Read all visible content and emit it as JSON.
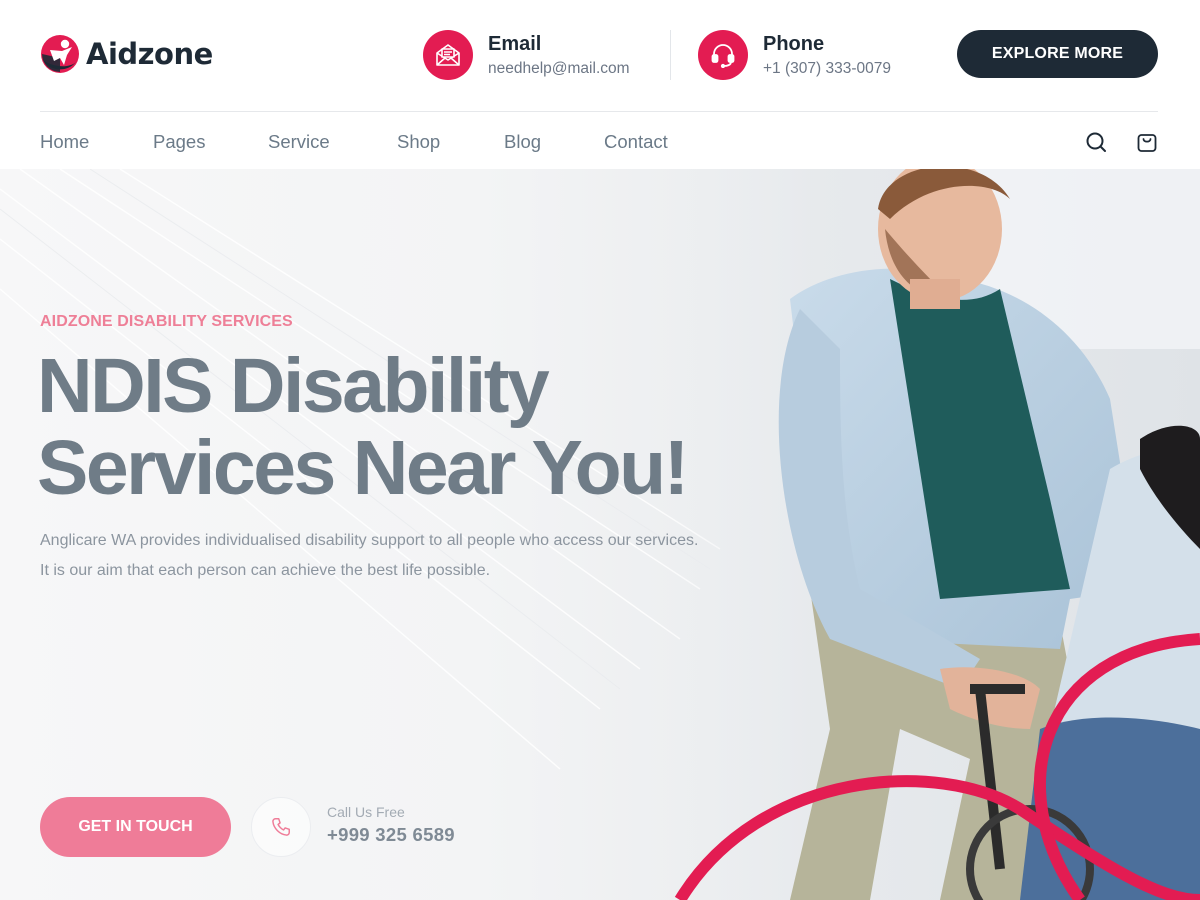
{
  "brand": {
    "name": "Aidzone",
    "accent": "#e31c52",
    "dark": "#1e2a36",
    "pink": "#ef7c98"
  },
  "header": {
    "email": {
      "title": "Email",
      "value": "needhelp@mail.com",
      "icon": "envelope-icon"
    },
    "phone": {
      "title": "Phone",
      "value": "+1 (307) 333-0079",
      "icon": "headset-icon"
    },
    "cta_label": "EXPLORE MORE"
  },
  "nav": {
    "items": [
      {
        "label": "Home"
      },
      {
        "label": "Pages"
      },
      {
        "label": "Service"
      },
      {
        "label": "Shop"
      },
      {
        "label": "Blog"
      },
      {
        "label": "Contact"
      }
    ],
    "icons": [
      "search-icon",
      "cart-icon"
    ]
  },
  "hero": {
    "eyebrow": "AIDZONE DISABILITY SERVICES",
    "headline_line1": "NDIS Disability",
    "headline_line2": "Services Near You!",
    "description_line1": "Anglicare WA provides individualised disability support to all people who access our services.",
    "description_line2": "It is our aim that each person can achieve the best life possible.",
    "button_label": "GET IN TOUCH",
    "call_label": "Call Us Free",
    "call_number": "+999 325 6589"
  }
}
